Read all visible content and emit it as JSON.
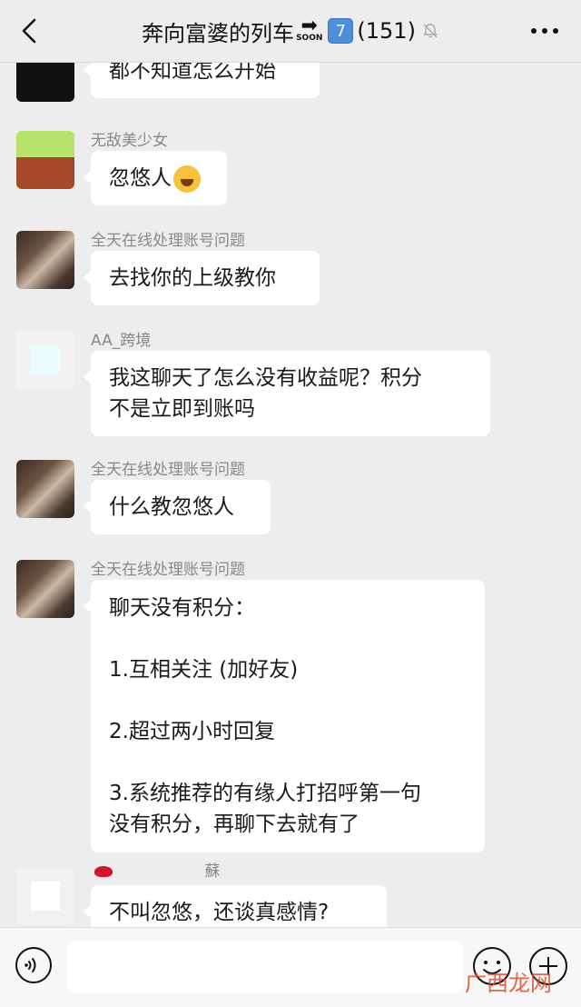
{
  "header": {
    "title": "奔向富婆的列车",
    "arrow_glyph": "➡",
    "soon_label": "SOON",
    "keycap": "7",
    "member_count": "(151)"
  },
  "messages": [
    {
      "sender": "",
      "lines": [
        "都不知道怎么开始"
      ]
    },
    {
      "sender": "无敌美少女",
      "lines": [
        "忽悠人"
      ],
      "emoji": "laughing-crying-emoji"
    },
    {
      "sender": "全天在线处理账号问题",
      "lines": [
        "去找你的上级教你"
      ]
    },
    {
      "sender": "AA_跨境",
      "lines": [
        "我这聊天了怎么没有收益呢？积分",
        "不是立即到账吗"
      ]
    },
    {
      "sender": "全天在线处理账号问题",
      "lines": [
        "什么教忽悠人"
      ]
    },
    {
      "sender": "全天在线处理账号问题",
      "lines": [
        "聊天没有积分：",
        "",
        "1.互相关注 (加好友)",
        "",
        "2.超过两小时回复",
        "",
        "3.系统推荐的有缘人打招呼第一句",
        "没有积分，再聊下去就有了"
      ]
    },
    {
      "sender": "蘇",
      "lines": [
        "不叫忽悠，还谈真感情?"
      ]
    }
  ],
  "watermark": "广西龙网",
  "colors": {
    "background": "#ededed",
    "bubble": "#ffffff",
    "sender_text": "#888888",
    "watermark": "#e04a2f"
  }
}
